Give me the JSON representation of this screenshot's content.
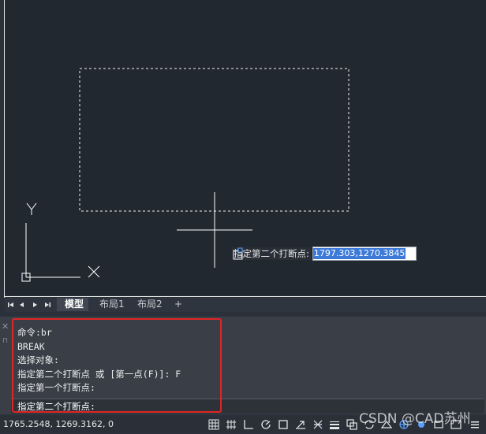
{
  "dynamic_input": {
    "prompt": "指定第二个打断点:",
    "value": "1797.303,1270.3845"
  },
  "layout_tabs": {
    "model": "模型",
    "layout1": "布局1",
    "layout2": "布局2",
    "add": "+"
  },
  "ucs": {
    "y_label": "Y"
  },
  "command_history": [
    "命令:br",
    "BREAK",
    "选择对象:",
    "指定第二个打断点 或 [第一点(F)]: F",
    "指定第一个打断点:"
  ],
  "command_input": "指定第二个打断点:",
  "status": {
    "coordinates": "1765.2548, 1269.3162, 0"
  },
  "watermark": "CSDN @CAD苏州",
  "colors": {
    "canvas": "#212830",
    "highlight": "#e12424",
    "selection": "#3c7ad8"
  }
}
